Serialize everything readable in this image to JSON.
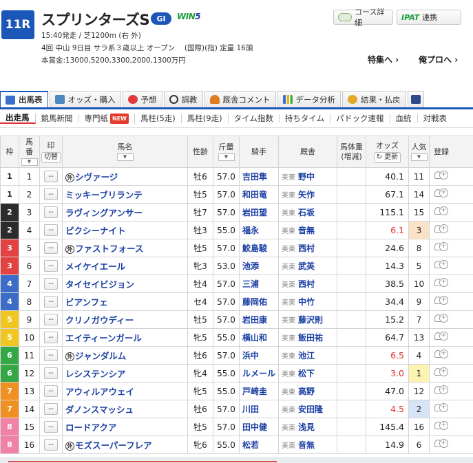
{
  "race": {
    "number": "11R",
    "name": "スプリンターズS",
    "grade": "GI",
    "win5_a": "WIN",
    "win5_b": "5",
    "line1": "15:40発走 / 芝1200m (右 外)",
    "line2": "4回 中山 9日目 サラ系３歳以上 オープン　 (国際)(指) 定量 16頭",
    "line3": "本賞金:13000,5200,3300,2000,1300万円"
  },
  "header_buttons": {
    "course": "コース詳細",
    "ipat_logo": "IPAT",
    "ipat": "連携",
    "special": "特集へ",
    "ore_pro": "俺プロへ"
  },
  "main_tabs": [
    {
      "label": "出馬表",
      "icon": "list-icon"
    },
    {
      "label": "オッズ・購入",
      "icon": "odds-icon"
    },
    {
      "label": "予想",
      "icon": "target-icon"
    },
    {
      "label": "調教",
      "icon": "clock-icon"
    },
    {
      "label": "厩舎コメント",
      "icon": "stable-icon"
    },
    {
      "label": "データ分析",
      "icon": "chart-icon"
    },
    {
      "label": "結果・払戻",
      "icon": "coin-icon"
    }
  ],
  "sub_tabs": [
    "出走馬",
    "競馬新聞",
    "専門紙",
    "馬柱(5走)",
    "馬柱(9走)",
    "タイム指数",
    "持ちタイム",
    "パドック速報",
    "血統",
    "対戦表"
  ],
  "new_badge": "NEW",
  "columns": {
    "frame": "枠",
    "num_a": "馬",
    "num_b": "番",
    "mark": "印",
    "mark_btn": "切替",
    "name": "馬名",
    "sex_age": "性齢",
    "weight": "斤量",
    "jockey": "騎手",
    "trainer": "厩舎",
    "body_weight_a": "馬体重",
    "body_weight_b": "(増減)",
    "odds": "オッズ",
    "odds_btn": "更新",
    "popularity": "人気",
    "register": "登録"
  },
  "mark_placeholder": "--",
  "region_label": "美東",
  "horses": [
    {
      "frame": "1",
      "num": "1",
      "foreign": true,
      "name": "シヴァージ",
      "sex_age": "牡6",
      "weight": "57.0",
      "jockey": "吉田隼",
      "trainer": "野中",
      "odds": "40.1",
      "pop": "11"
    },
    {
      "frame": "1",
      "num": "2",
      "foreign": false,
      "name": "ミッキーブリランテ",
      "sex_age": "牡5",
      "weight": "57.0",
      "jockey": "和田竜",
      "trainer": "矢作",
      "odds": "67.1",
      "pop": "14"
    },
    {
      "frame": "2",
      "num": "3",
      "foreign": false,
      "name": "ラヴィングアンサー",
      "sex_age": "牡7",
      "weight": "57.0",
      "jockey": "岩田望",
      "trainer": "石坂",
      "odds": "115.1",
      "pop": "15"
    },
    {
      "frame": "2",
      "num": "4",
      "foreign": false,
      "name": "ピクシーナイト",
      "sex_age": "牡3",
      "weight": "55.0",
      "jockey": "福永",
      "trainer": "音無",
      "odds": "6.1",
      "pop": "3"
    },
    {
      "frame": "3",
      "num": "5",
      "foreign": true,
      "name": "ファストフォース",
      "sex_age": "牡5",
      "weight": "57.0",
      "jockey": "鮫島駿",
      "trainer": "西村",
      "odds": "24.6",
      "pop": "8"
    },
    {
      "frame": "3",
      "num": "6",
      "foreign": false,
      "name": "メイケイエール",
      "sex_age": "牝3",
      "weight": "53.0",
      "jockey": "池添",
      "trainer": "武英",
      "odds": "14.3",
      "pop": "5"
    },
    {
      "frame": "4",
      "num": "7",
      "foreign": false,
      "name": "タイセイビジョン",
      "sex_age": "牡4",
      "weight": "57.0",
      "jockey": "三浦",
      "trainer": "西村",
      "odds": "38.5",
      "pop": "10"
    },
    {
      "frame": "4",
      "num": "8",
      "foreign": false,
      "name": "ビアンフェ",
      "sex_age": "セ4",
      "weight": "57.0",
      "jockey": "藤岡佑",
      "trainer": "中竹",
      "odds": "34.4",
      "pop": "9"
    },
    {
      "frame": "5",
      "num": "9",
      "foreign": false,
      "name": "クリノガウディー",
      "sex_age": "牡5",
      "weight": "57.0",
      "jockey": "岩田康",
      "trainer": "藤沢則",
      "odds": "15.2",
      "pop": "7"
    },
    {
      "frame": "5",
      "num": "10",
      "foreign": false,
      "name": "エイティーンガール",
      "sex_age": "牝5",
      "weight": "55.0",
      "jockey": "横山和",
      "trainer": "飯田祐",
      "odds": "64.7",
      "pop": "13"
    },
    {
      "frame": "6",
      "num": "11",
      "foreign": true,
      "name": "ジャンダルム",
      "sex_age": "牡6",
      "weight": "57.0",
      "jockey": "浜中",
      "trainer": "池江",
      "odds": "6.5",
      "pop": "4"
    },
    {
      "frame": "6",
      "num": "12",
      "foreign": false,
      "name": "レシステンシア",
      "sex_age": "牝4",
      "weight": "55.0",
      "jockey": "ルメール",
      "trainer": "松下",
      "odds": "3.0",
      "pop": "1"
    },
    {
      "frame": "7",
      "num": "13",
      "foreign": false,
      "name": "アウィルアウェイ",
      "sex_age": "牝5",
      "weight": "55.0",
      "jockey": "戸崎圭",
      "trainer": "高野",
      "odds": "47.0",
      "pop": "12"
    },
    {
      "frame": "7",
      "num": "14",
      "foreign": false,
      "name": "ダノンスマッシュ",
      "sex_age": "牡6",
      "weight": "57.0",
      "jockey": "川田",
      "trainer": "安田隆",
      "odds": "4.5",
      "pop": "2"
    },
    {
      "frame": "8",
      "num": "15",
      "foreign": false,
      "name": "ロードアクア",
      "sex_age": "牡5",
      "weight": "57.0",
      "jockey": "田中健",
      "trainer": "浅見",
      "odds": "145.4",
      "pop": "16"
    },
    {
      "frame": "8",
      "num": "16",
      "foreign": true,
      "name": "モズスーパーフレア",
      "sex_age": "牝6",
      "weight": "55.0",
      "jockey": "松若",
      "trainer": "音無",
      "odds": "14.9",
      "pop": "6"
    }
  ],
  "foreign_mark": "外",
  "colors": {
    "accent": "#1b57b8",
    "link": "#1a3fa3",
    "hot_odds": "#e03030",
    "frame_colors": [
      "#ffffff",
      "#2c2c2c",
      "#e34242",
      "#3b6cc7",
      "#f1c620",
      "#35a845",
      "#f09020",
      "#f182a5"
    ]
  }
}
